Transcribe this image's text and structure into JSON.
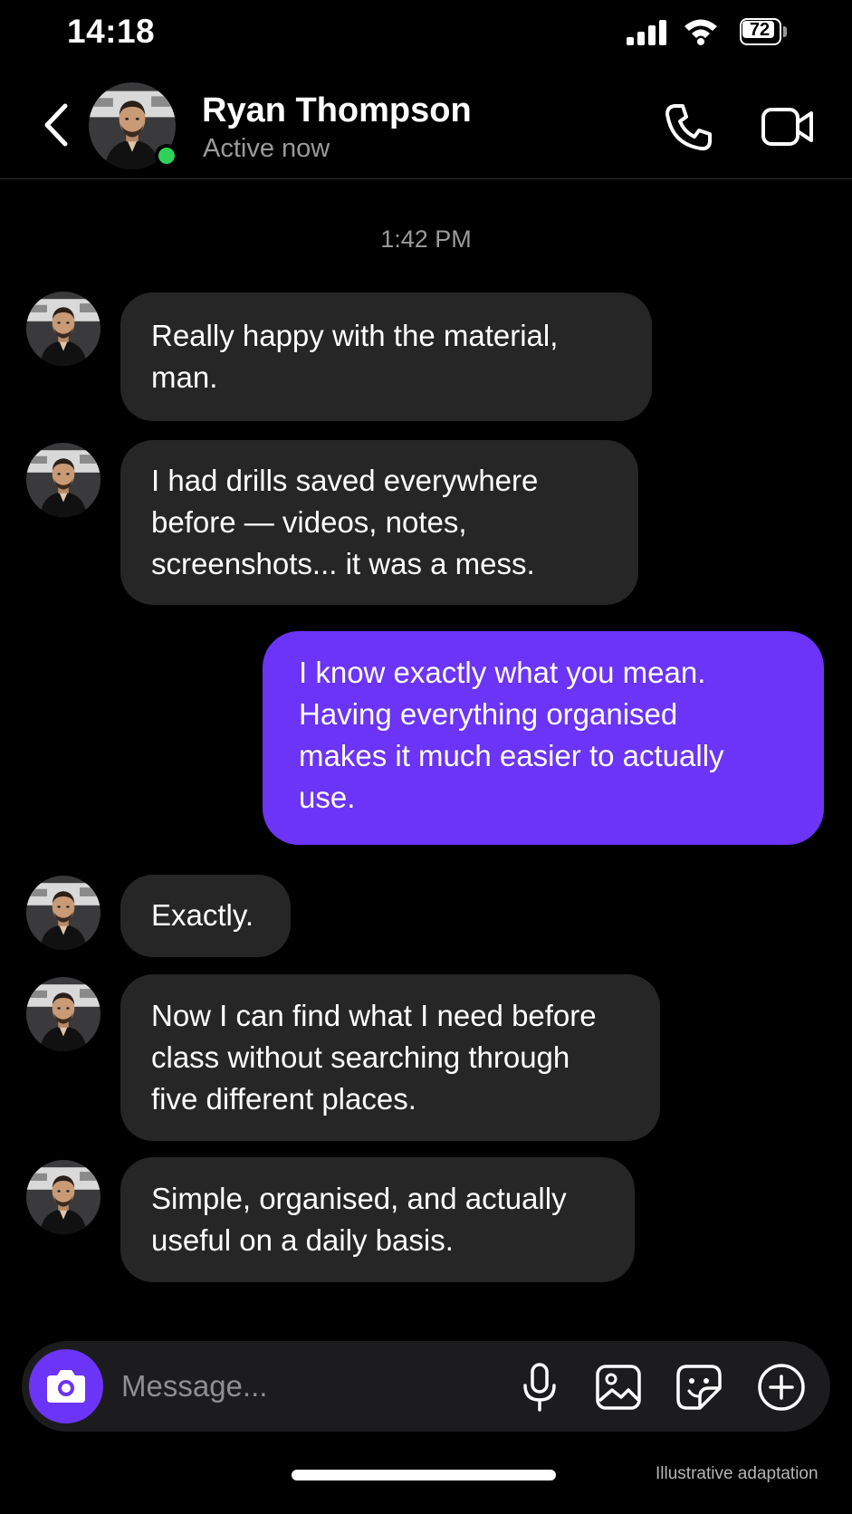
{
  "status_bar": {
    "time": "14:18",
    "battery": "72"
  },
  "header": {
    "contact_name": "Ryan Thompson",
    "status": "Active now",
    "icons": {
      "back": "chevron-left-icon",
      "call": "phone-icon",
      "video": "video-camera-icon"
    }
  },
  "conversation": {
    "timestamp": "1:42 PM",
    "messages": [
      {
        "from": "Ryan Thompson",
        "lines": [
          "Really happy with the material,",
          "man."
        ]
      },
      {
        "from": "Ryan Thompson",
        "lines": [
          "I had drills saved everywhere",
          "before — videos, notes,",
          "screenshots... it was a mess."
        ]
      },
      {
        "from": "me",
        "lines": [
          "I know exactly what you mean.",
          "Having everything organised",
          "makes it much easier to actually",
          "use."
        ]
      },
      {
        "from": "Ryan Thompson",
        "lines": [
          "Exactly."
        ]
      },
      {
        "from": "Ryan Thompson",
        "lines": [
          "Now I can find what I need before",
          "class without searching through",
          "five different places."
        ]
      },
      {
        "from": "Ryan Thompson",
        "lines": [
          "Simple, organised, and actually",
          "useful on a daily basis."
        ]
      }
    ]
  },
  "composer": {
    "placeholder": "Message...",
    "icons": [
      "camera-icon",
      "microphone-icon",
      "image-icon",
      "sticker-icon",
      "plus-circle-icon"
    ]
  },
  "footer": {
    "caption": "Illustrative adaptation"
  },
  "colors": {
    "background": "#000000",
    "incoming_bubble": "#262626",
    "outgoing_bubble": "#6b34f6",
    "online": "#2fd158"
  }
}
